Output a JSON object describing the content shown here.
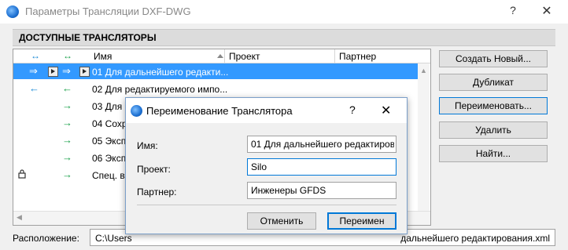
{
  "window": {
    "title": "Параметры Трансляции DXF-DWG",
    "help": "?",
    "close": "✕"
  },
  "section": {
    "title": "ДОСТУПНЫЕ ТРАНСЛЯТОРЫ"
  },
  "list": {
    "header_arrow_both": "↔",
    "columns": {
      "name": "Имя",
      "project": "Проект",
      "partner": "Партнер"
    },
    "rows": [
      {
        "arrow1": "⇒",
        "arrow2": "⇒",
        "name": "01 Для дальнейшего редакти...",
        "selected": true
      },
      {
        "arrow1": "←",
        "arrow2": "←",
        "name": "02 Для редактируемого импо..."
      },
      {
        "arrow1": "",
        "arrow2": "→",
        "name": "03 Для в"
      },
      {
        "arrow1": "",
        "arrow2": "→",
        "name": "04 Сохр"
      },
      {
        "arrow1": "",
        "arrow2": "→",
        "name": "05 Эксп"
      },
      {
        "arrow1": "",
        "arrow2": "→",
        "name": "06 Эксп"
      },
      {
        "arrow1": "",
        "arrow2": "→",
        "name": "Спец. вс",
        "locked": true
      }
    ]
  },
  "actions": {
    "create_new": "Создать Новый...",
    "duplicate": "Дубликат",
    "rename": "Переименовать...",
    "delete": "Удалить",
    "find": "Найти..."
  },
  "location": {
    "label": "Расположение:",
    "path_start": "C:\\Users",
    "path_end": "дальнейшего редактирования.xml"
  },
  "dialog": {
    "title": "Переименование Транслятора",
    "help": "?",
    "close": "✕",
    "name_label": "Имя:",
    "name_value": "01 Для дальнейшего редактирова",
    "project_label": "Проект:",
    "project_value": "Silo",
    "partner_label": "Партнер:",
    "partner_value": "Инженеры GFDS",
    "cancel": "Отменить",
    "ok": "Переимен"
  },
  "colors": {
    "selection": "#3399ff",
    "focus": "#0078d7",
    "arrow_blue": "#1a8ad6",
    "arrow_green": "#1aa04a"
  }
}
